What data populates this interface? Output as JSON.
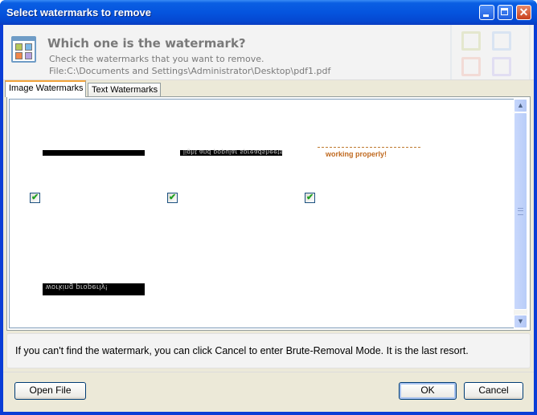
{
  "window": {
    "title": "Select watermarks to remove",
    "controls": {
      "minimize": "minimize-icon",
      "maximize": "maximize-icon",
      "close": "close-icon"
    }
  },
  "header": {
    "icon": "watermark-grid-icon",
    "title": "Which one is the watermark?",
    "subtitle": "Check the watermarks that you want to remove.",
    "file": "File:C:\\Documents and Settings\\Administrator\\Desktop\\pdf1.pdf"
  },
  "tabs": [
    {
      "label": "Image Watermarks",
      "active": true
    },
    {
      "label": "Text Watermarks",
      "active": false
    }
  ],
  "watermarks": [
    {
      "type": "black-bar",
      "text": "",
      "checked": true
    },
    {
      "type": "black-bar",
      "text": "light and popular spreadsheets",
      "checked": true
    },
    {
      "type": "orange-text",
      "text": "working properly!",
      "checked": true
    },
    {
      "type": "black-bar",
      "text": "working properly!",
      "checked": null
    }
  ],
  "info": {
    "message": "If you can't find the watermark, you can click Cancel to enter Brute-Removal Mode. It is the last resort."
  },
  "buttons": {
    "open_file": "Open File",
    "ok": "OK",
    "cancel": "Cancel"
  },
  "colors": {
    "titlebar": "#0554de",
    "tab_accent": "#f2a33a",
    "check": "#21a121"
  }
}
